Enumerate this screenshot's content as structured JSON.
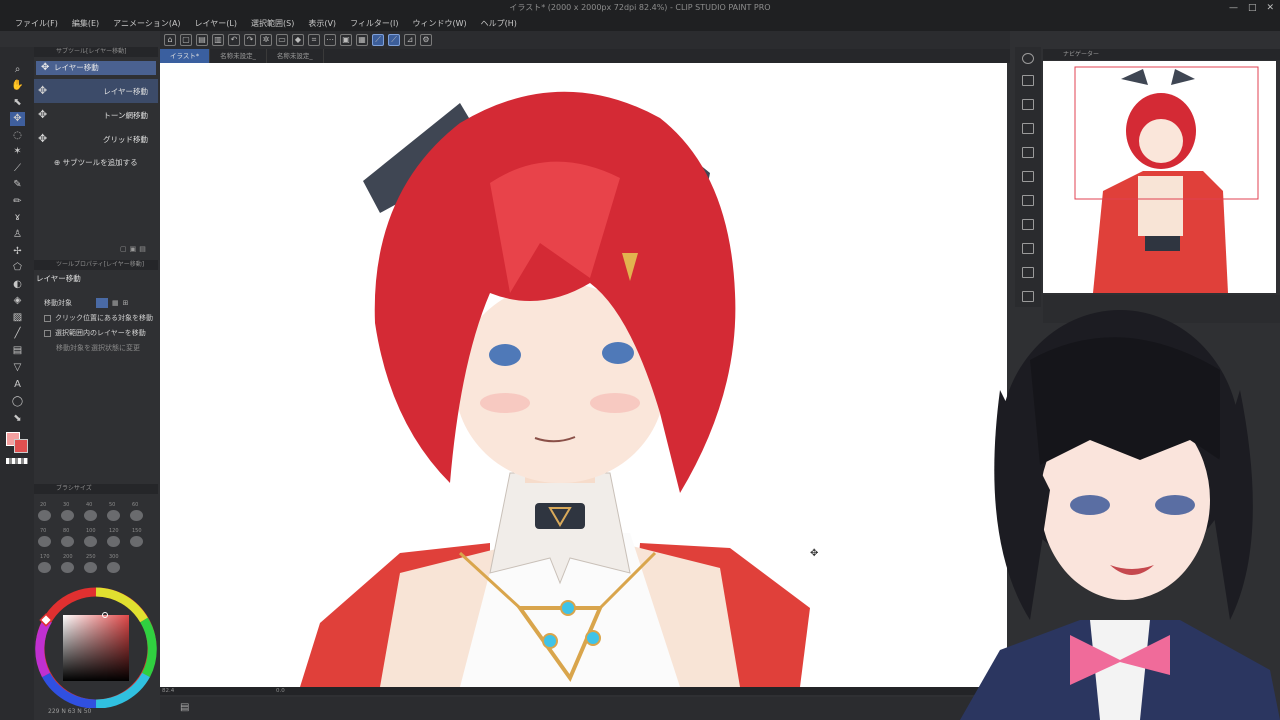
{
  "app": {
    "title": "イラスト* (2000 x 2000px 72dpi 82.4%) - CLIP STUDIO PAINT PRO",
    "window_controls": [
      "—",
      "□",
      "✕"
    ]
  },
  "menu": [
    "ファイル(F)",
    "編集(E)",
    "アニメーション(A)",
    "レイヤー(L)",
    "選択範囲(S)",
    "表示(V)",
    "フィルター(I)",
    "ウィンドウ(W)",
    "ヘルプ(H)"
  ],
  "subtool_panel": {
    "header": "サブツール[レイヤー移動]",
    "group_tab": "レイヤー移動",
    "items": [
      {
        "label": "レイヤー移動",
        "selected": true
      },
      {
        "label": "トーン網移動",
        "selected": false
      },
      {
        "label": "グリッド移動",
        "selected": false
      }
    ],
    "add_label": "サブツールを追加する"
  },
  "tool_property": {
    "header": "ツールプロパティ[レイヤー移動]",
    "name": "レイヤー移動",
    "target_label": "移動対象",
    "options": [
      {
        "label": "クリック位置にある対象を移動",
        "checked": false
      },
      {
        "label": "選択範囲内のレイヤーを移動",
        "checked": false
      }
    ],
    "disabled_option": "移動対象を選択状態に変更"
  },
  "brush_size": {
    "header": "ブラシサイズ",
    "sizes": [
      "20",
      "30",
      "40",
      "50",
      "60",
      "70",
      "80",
      "100",
      "120",
      "150",
      "170",
      "200",
      "250",
      "300"
    ]
  },
  "document_tabs": [
    "イラスト*",
    "名称未設定_",
    "名称未設定_"
  ],
  "canvas_status": {
    "zoom": "82.4",
    "rotation": "0.0",
    "status_line": "229 N 63 N 50"
  },
  "navigator": {
    "header": "ナビゲーター"
  },
  "colors": {
    "accent": "#3f5f9d",
    "main_color": "#f4a0a0",
    "sub_color": "#e05050",
    "hair": "#d42a35",
    "jacket": "#e0403a"
  }
}
